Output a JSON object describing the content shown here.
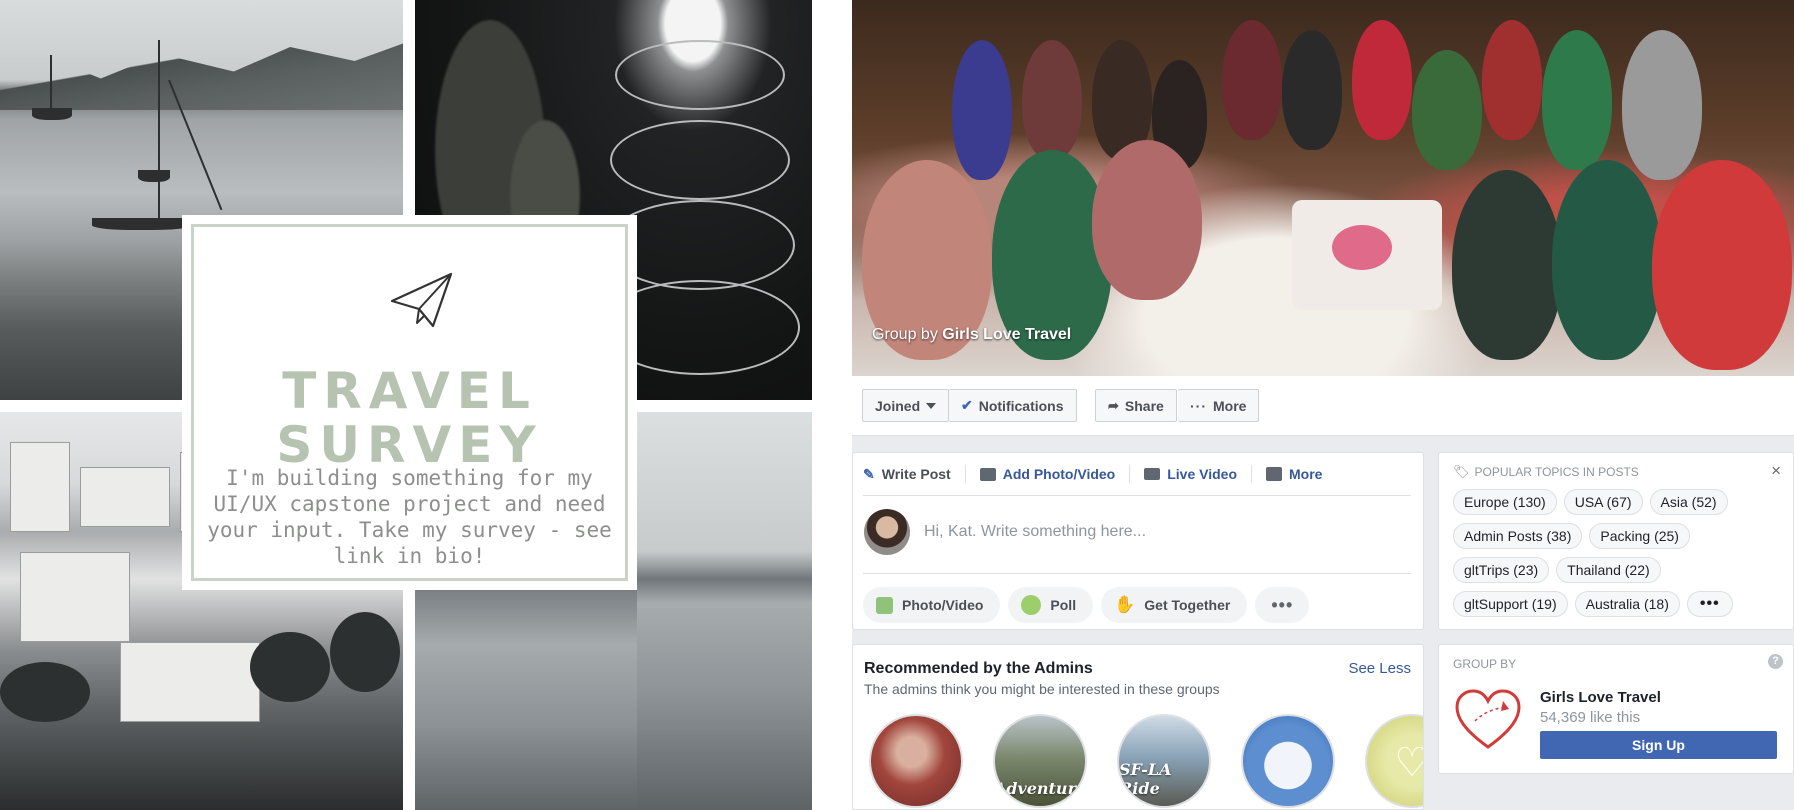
{
  "survey_card": {
    "title_line1": "TRAVEL",
    "title_line2": "SURVEY",
    "body": "I'm building something for my UI/UX capstone project and need your input. Take my survey - see link in bio!"
  },
  "cover": {
    "caption_prefix": "Group by",
    "caption_group": "Girls Love Travel"
  },
  "actionbar": {
    "joined": "Joined",
    "notifications": "Notifications",
    "share": "Share",
    "more": "More"
  },
  "composer": {
    "tabs": [
      "Write Post",
      "Add Photo/Video",
      "Live Video",
      "More"
    ],
    "placeholder": "Hi, Kat. Write something here...",
    "pills": [
      "Photo/Video",
      "Poll",
      "Get Together"
    ]
  },
  "topics": {
    "heading": "POPULAR TOPICS IN POSTS",
    "tags": [
      "Europe (130)",
      "USA (67)",
      "Asia (52)",
      "Admin Posts (38)",
      "Packing (25)",
      "gltTrips (23)",
      "Thailand (22)",
      "gltSupport (19)",
      "Australia (18)"
    ]
  },
  "recommended": {
    "title": "Recommended by the Admins",
    "subtitle": "The admins think you might be interested in these groups",
    "see_less": "See Less",
    "circle_labels": [
      "Adventure",
      "SF-LA Ride"
    ]
  },
  "group_by": {
    "heading": "GROUP BY",
    "name": "Girls Love Travel",
    "likes": "54,369 like this",
    "signup": "Sign Up"
  },
  "colors": {
    "facebook_blue": "#4267b2",
    "link_blue": "#365899",
    "sage_green": "#b5c3b0",
    "heart_red": "#d33a3a"
  }
}
